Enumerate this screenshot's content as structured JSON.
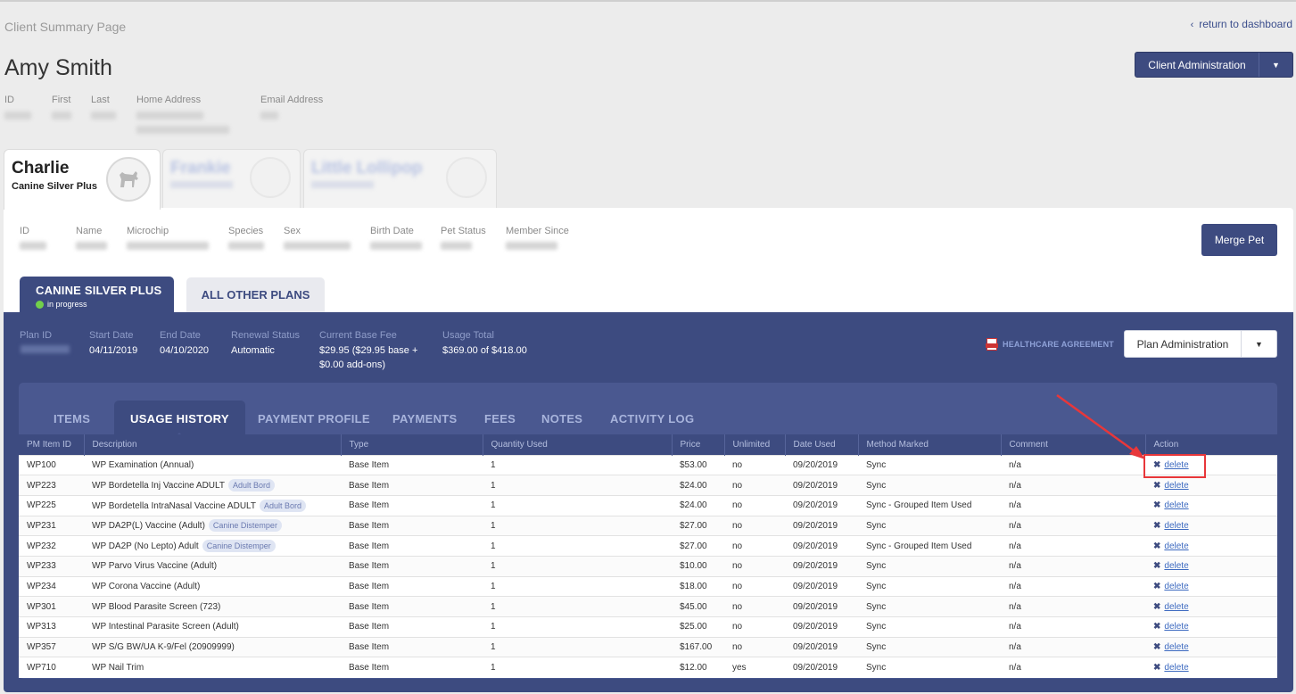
{
  "page": {
    "label": "Client Summary Page",
    "return_link": "return to dashboard",
    "return_icon": "chevron-left-icon"
  },
  "client": {
    "name": "Amy Smith",
    "admin_button": "Client Administration",
    "fields": [
      {
        "label": "ID"
      },
      {
        "label": "First"
      },
      {
        "label": "Last"
      },
      {
        "label": "Home Address"
      },
      {
        "label": "Email Address"
      }
    ]
  },
  "pets": {
    "active": {
      "name": "Charlie",
      "plan": "Canine Silver Plus",
      "avatar_icon": "dog-icon"
    },
    "others": [
      {
        "name": "Frankie"
      },
      {
        "name": "Little Lollipop"
      }
    ],
    "info_labels": [
      "ID",
      "Name",
      "Microchip",
      "Species",
      "Sex",
      "Birth Date",
      "Pet Status",
      "Member Since"
    ],
    "merge_button": "Merge Pet"
  },
  "plan_tabs": {
    "active": {
      "label": "CANINE SILVER PLUS",
      "status": "in progress",
      "status_color": "#72d04a"
    },
    "other": {
      "label": "ALL OTHER PLANS"
    }
  },
  "plan": {
    "labels": {
      "plan_id": "Plan ID",
      "start_date": "Start Date",
      "end_date": "End Date",
      "renewal_status": "Renewal Status",
      "current_base_fee": "Current Base Fee",
      "usage_total": "Usage Total"
    },
    "values": {
      "start_date": "04/11/2019",
      "end_date": "04/10/2020",
      "renewal_status": "Automatic",
      "current_base_fee": "$29.95 ($29.95 base + $0.00 add-ons)",
      "usage_total": "$369.00 of $418.00"
    },
    "healthcare_agreement": "HEALTHCARE AGREEMENT",
    "healthcare_icon": "pdf-icon",
    "admin_button": "Plan Administration"
  },
  "detail_tabs": [
    "ITEMS",
    "USAGE HISTORY",
    "PAYMENT PROFILE",
    "PAYMENTS",
    "FEES",
    "NOTES",
    "ACTIVITY LOG"
  ],
  "usage_table": {
    "headers": [
      "PM Item ID",
      "Description",
      "Type",
      "Quantity Used",
      "Price",
      "Unlimited",
      "Date Used",
      "Method Marked",
      "Comment",
      "Action"
    ],
    "action_label": "delete",
    "action_icon": "close-icon",
    "rows": [
      {
        "id": "WP100",
        "desc": "WP Examination (Annual)",
        "tag": "",
        "type": "Base Item",
        "qty": "1",
        "price": "$53.00",
        "unlimited": "no",
        "date": "09/20/2019",
        "method": "Sync",
        "comment": "n/a"
      },
      {
        "id": "WP223",
        "desc": "WP Bordetella Inj Vaccine ADULT",
        "tag": "Adult Bord",
        "type": "Base Item",
        "qty": "1",
        "price": "$24.00",
        "unlimited": "no",
        "date": "09/20/2019",
        "method": "Sync",
        "comment": "n/a"
      },
      {
        "id": "WP225",
        "desc": "WP Bordetella IntraNasal Vaccine ADULT",
        "tag": "Adult Bord",
        "type": "Base Item",
        "qty": "1",
        "price": "$24.00",
        "unlimited": "no",
        "date": "09/20/2019",
        "method": "Sync - Grouped Item Used",
        "comment": "n/a"
      },
      {
        "id": "WP231",
        "desc": "WP DA2P(L) Vaccine (Adult)",
        "tag": "Canine Distemper",
        "type": "Base Item",
        "qty": "1",
        "price": "$27.00",
        "unlimited": "no",
        "date": "09/20/2019",
        "method": "Sync",
        "comment": "n/a"
      },
      {
        "id": "WP232",
        "desc": "WP DA2P (No Lepto) Adult",
        "tag": "Canine Distemper",
        "type": "Base Item",
        "qty": "1",
        "price": "$27.00",
        "unlimited": "no",
        "date": "09/20/2019",
        "method": "Sync - Grouped Item Used",
        "comment": "n/a"
      },
      {
        "id": "WP233",
        "desc": "WP Parvo Virus Vaccine (Adult)",
        "tag": "",
        "type": "Base Item",
        "qty": "1",
        "price": "$10.00",
        "unlimited": "no",
        "date": "09/20/2019",
        "method": "Sync",
        "comment": "n/a"
      },
      {
        "id": "WP234",
        "desc": "WP Corona Vaccine (Adult)",
        "tag": "",
        "type": "Base Item",
        "qty": "1",
        "price": "$18.00",
        "unlimited": "no",
        "date": "09/20/2019",
        "method": "Sync",
        "comment": "n/a"
      },
      {
        "id": "WP301",
        "desc": "WP Blood Parasite Screen (723)",
        "tag": "",
        "type": "Base Item",
        "qty": "1",
        "price": "$45.00",
        "unlimited": "no",
        "date": "09/20/2019",
        "method": "Sync",
        "comment": "n/a"
      },
      {
        "id": "WP313",
        "desc": "WP Intestinal Parasite Screen (Adult)",
        "tag": "",
        "type": "Base Item",
        "qty": "1",
        "price": "$25.00",
        "unlimited": "no",
        "date": "09/20/2019",
        "method": "Sync",
        "comment": "n/a"
      },
      {
        "id": "WP357",
        "desc": "WP S/G BW/UA K-9/Fel (20909999)",
        "tag": "",
        "type": "Base Item",
        "qty": "1",
        "price": "$167.00",
        "unlimited": "no",
        "date": "09/20/2019",
        "method": "Sync",
        "comment": "n/a"
      },
      {
        "id": "WP710",
        "desc": "WP Nail Trim",
        "tag": "",
        "type": "Base Item",
        "qty": "1",
        "price": "$12.00",
        "unlimited": "yes",
        "date": "09/20/2019",
        "method": "Sync",
        "comment": "n/a"
      }
    ]
  },
  "annotation": {
    "color": "#e8373a"
  }
}
